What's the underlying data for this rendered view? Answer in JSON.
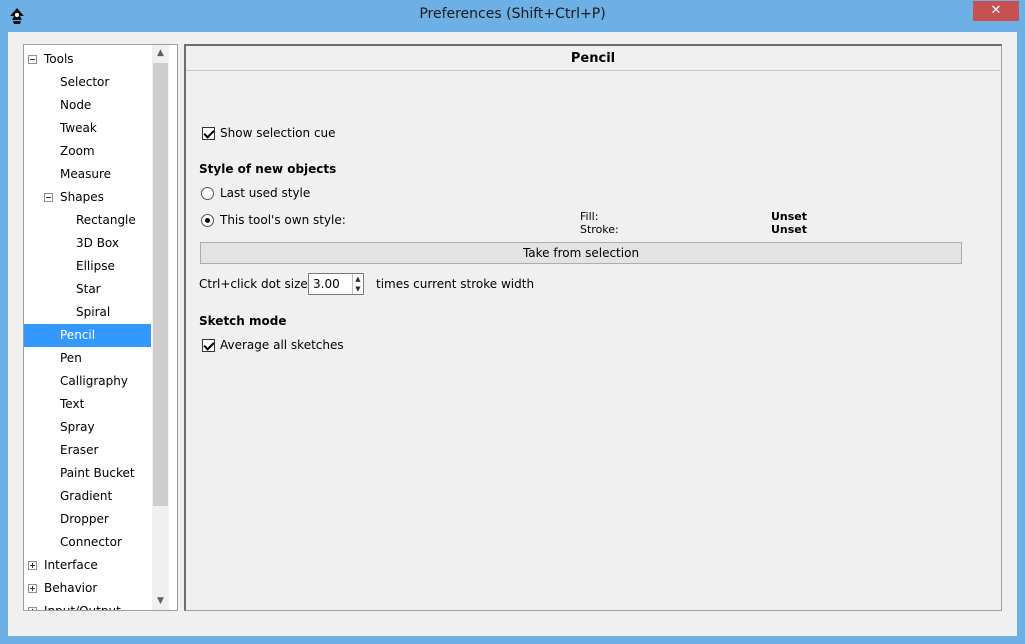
{
  "window": {
    "title": "Preferences (Shift+Ctrl+P)",
    "close_label": "✕"
  },
  "tree": {
    "items": [
      {
        "label": "Tools",
        "expander": "minus"
      },
      {
        "label": "Selector"
      },
      {
        "label": "Node"
      },
      {
        "label": "Tweak"
      },
      {
        "label": "Zoom"
      },
      {
        "label": "Measure"
      },
      {
        "label": "Shapes",
        "expander": "minus"
      },
      {
        "label": "Rectangle"
      },
      {
        "label": "3D Box"
      },
      {
        "label": "Ellipse"
      },
      {
        "label": "Star"
      },
      {
        "label": "Spiral"
      },
      {
        "label": "Pencil",
        "selected": true
      },
      {
        "label": "Pen"
      },
      {
        "label": "Calligraphy"
      },
      {
        "label": "Text"
      },
      {
        "label": "Spray"
      },
      {
        "label": "Eraser"
      },
      {
        "label": "Paint Bucket"
      },
      {
        "label": "Gradient"
      },
      {
        "label": "Dropper"
      },
      {
        "label": "Connector"
      },
      {
        "label": "Interface",
        "expander": "plus"
      },
      {
        "label": "Behavior",
        "expander": "plus"
      },
      {
        "label": "Input/Output",
        "expander": "plus"
      }
    ],
    "scroll_up": "▲",
    "scroll_down": "▼"
  },
  "panel": {
    "title": "Pencil",
    "show_selection_cue": {
      "label": "Show selection cue",
      "checked": true
    },
    "style_section": "Style of new objects",
    "last_used_style": {
      "label": "Last used style",
      "checked": false
    },
    "own_style": {
      "label": "This tool's own style:",
      "checked": true
    },
    "fill_label": "Fill:",
    "fill_value": "Unset",
    "stroke_label": "Stroke:",
    "stroke_value": "Unset",
    "take_from_selection": "Take from selection",
    "dot_size_label": "Ctrl+click dot size:",
    "dot_size_value": "3.00",
    "dot_size_suffix": "times current stroke width",
    "sketch_section": "Sketch mode",
    "average_sketches": {
      "label": "Average all sketches",
      "checked": true
    },
    "spin_up": "▲",
    "spin_down": "▼"
  },
  "colors": {
    "titlebar": "#6cb0e6",
    "selection": "#3399ff",
    "close": "#c75050"
  }
}
